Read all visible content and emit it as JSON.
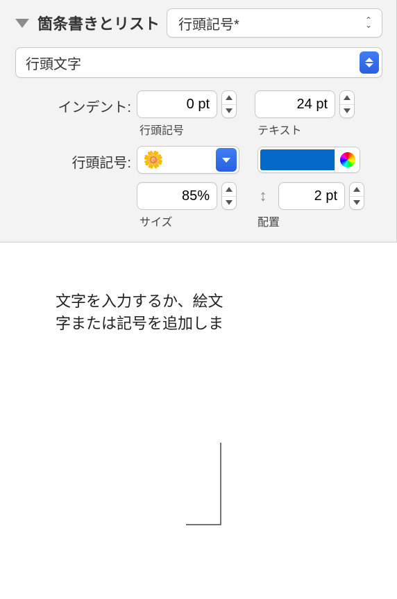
{
  "header": {
    "title": "箇条書きとリスト",
    "style_popup": "行頭記号*"
  },
  "type_select": "行頭文字",
  "indent": {
    "label": "インデント:",
    "bullet": {
      "value": "0 pt",
      "sublabel": "行頭記号"
    },
    "text": {
      "value": "24 pt",
      "sublabel": "テキスト"
    }
  },
  "bullet": {
    "label": "行頭記号:",
    "emoji": "🌼",
    "color": "#0469c6"
  },
  "size": {
    "value": "85%",
    "sublabel": "サイズ"
  },
  "align": {
    "value": "2 pt",
    "sublabel": "配置"
  },
  "callout": {
    "line1": "文字を入力するか、絵文",
    "line2": "字または記号を追加しま"
  }
}
